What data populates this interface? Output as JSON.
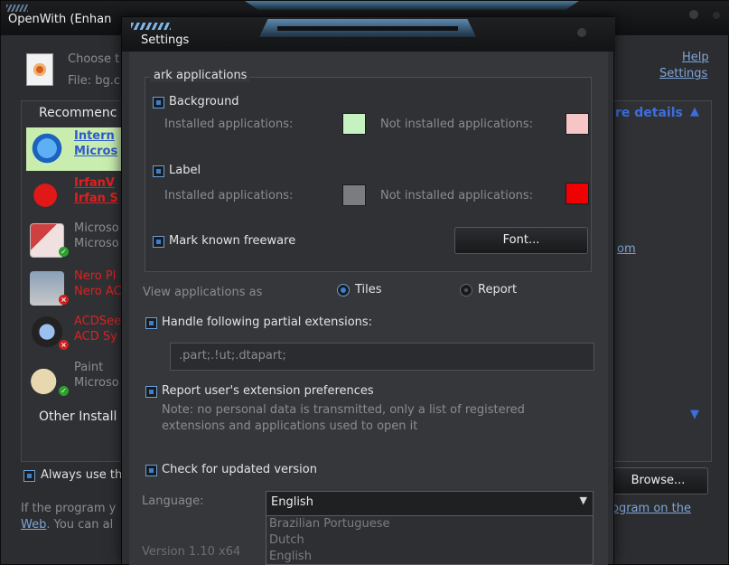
{
  "back_window": {
    "title": "OpenWith (Enhan",
    "choose_text": "Choose t",
    "file_text": "File: bg.c",
    "help_link": "Help",
    "settings_link": "Settings",
    "recommended_label": "Recommenc",
    "more_details": "re details",
    "recommended_apps": [
      {
        "name1": "Intern",
        "name2": "Micros",
        "style": "highlight",
        "badge": "check"
      },
      {
        "name1": "IrfanV",
        "name2": "Irfan S",
        "style": "red-bold",
        "badge": "none"
      },
      {
        "name1": "Microso",
        "name2": "Microso",
        "style": "grey",
        "badge": "check"
      },
      {
        "name1": "Nero Pl",
        "name2": "Nero AC",
        "style": "red",
        "badge": "x"
      },
      {
        "name1": "ACDSee",
        "name2": "ACD Sy",
        "style": "red",
        "badge": "x"
      },
      {
        "name1": "Paint",
        "name2": "Microso",
        "style": "grey",
        "badge": "check"
      }
    ],
    "partial_link": "om",
    "other_installed": "Other Install",
    "always_use": "Always use th",
    "browse_button": "Browse...",
    "if_program_text": "If the program y",
    "web_link": "Web",
    "you_can_text": ". You can al",
    "program_link": "ogram on the"
  },
  "dialog": {
    "title": "Settings",
    "group_title": "ark applications",
    "background": {
      "label": "Background",
      "installed_label": "Installed applications:",
      "not_installed_label": "Not installed applications:",
      "installed_color": "#c6f2c2",
      "not_installed_color": "#f6c6c6"
    },
    "label_section": {
      "label": "Label",
      "installed_label": "Installed applications:",
      "not_installed_label": "Not installed applications:",
      "installed_color": "#7a7c80",
      "not_installed_color": "#f00000"
    },
    "mark_freeware": "Mark known freeware",
    "font_button": "Font...",
    "view_as_label": "View applications as",
    "view_options": [
      "Tiles",
      "Report"
    ],
    "view_selected": "Tiles",
    "handle_partial": "Handle following partial extensions:",
    "partial_extensions_value": ".part;.!ut;.dtapart;",
    "report_prefs": "Report user's extension preferences",
    "report_note_line1": "Note: no personal data is transmitted, only a list of registered",
    "report_note_line2": "extensions and applications used to open it",
    "check_updates": "Check for updated version",
    "language_label": "Language:",
    "language_value": "English",
    "language_options": [
      "Brazilian Portuguese",
      "Dutch",
      "English"
    ],
    "version_text": "Version 1.10 x64"
  }
}
